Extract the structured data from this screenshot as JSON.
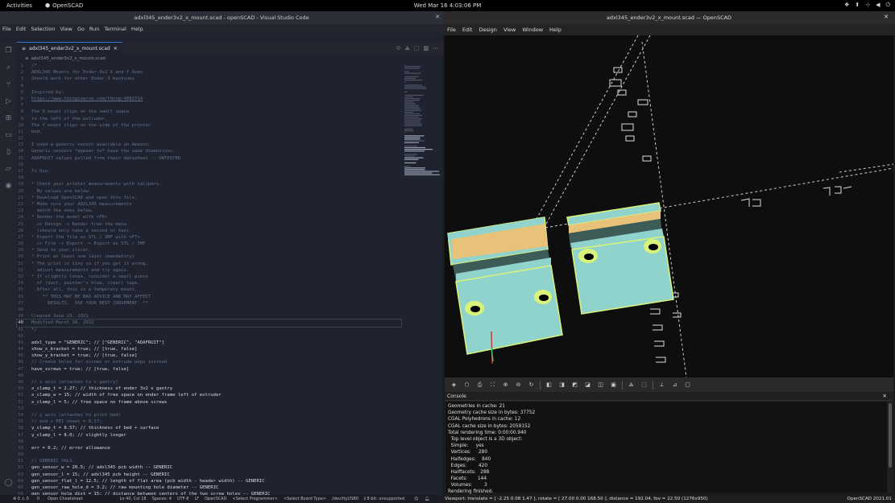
{
  "topbar": {
    "activities": "Activities",
    "app_name": "OpenSCAD",
    "clock": "Wed Mar 16  4:03:06 PM"
  },
  "vscode": {
    "title": "adxl345_ender3v2_x_mount.scad - openSCAD - Visual Studio Code",
    "menu": [
      "File",
      "Edit",
      "Selection",
      "View",
      "Go",
      "Run",
      "Terminal",
      "Help"
    ],
    "tab_label": "adxl345_ender3v2_x_mount.scad",
    "breadcrumb": "adxl345_ender3v2_x_mount.scad",
    "lines": [
      {
        "n": "1",
        "t": "/*",
        "c": "com"
      },
      {
        "n": "2",
        "t": "ADXL345 Mounts for Ender-3v2 X and Y Axes",
        "c": "com"
      },
      {
        "n": "3",
        "t": "Should work for other Ender-3 machines",
        "c": "com"
      },
      {
        "n": "4",
        "t": "",
        "c": "com"
      },
      {
        "n": "5",
        "t": "Inspired by:",
        "c": "com"
      },
      {
        "n": "6",
        "t": "https://www.thingiverse.com/thing:4882714",
        "c": "link"
      },
      {
        "n": "7",
        "t": "",
        "c": "com"
      },
      {
        "n": "8",
        "t": "The X mount clips on the small space",
        "c": "com"
      },
      {
        "n": "9",
        "t": "to the left of the extruder.",
        "c": "com"
      },
      {
        "n": "10",
        "t": "The Y mount clips on the side of the printer",
        "c": "com"
      },
      {
        "n": "11",
        "t": "bed.",
        "c": "com"
      },
      {
        "n": "12",
        "t": "",
        "c": "com"
      },
      {
        "n": "13",
        "t": "I used a generic sensor available on Amazon.",
        "c": "com"
      },
      {
        "n": "14",
        "t": "Generic sensors *appear to* have the same dimensions.",
        "c": "com"
      },
      {
        "n": "15",
        "t": "ADAFRUIT values pulled from their datasheet -- UNTESTED",
        "c": "com"
      },
      {
        "n": "16",
        "t": "",
        "c": "com"
      },
      {
        "n": "17",
        "t": "To Use:",
        "c": "com"
      },
      {
        "n": "18",
        "t": "",
        "c": "com"
      },
      {
        "n": "19",
        "t": "* Check your printer measurements with calipers.",
        "c": "com"
      },
      {
        "n": "20",
        "t": "  My values are below.",
        "c": "com"
      },
      {
        "n": "21",
        "t": "* Download OpenSCAD and open this file.",
        "c": "com"
      },
      {
        "n": "22",
        "t": "* Make sure your ADXL345 measurements",
        "c": "com"
      },
      {
        "n": "23",
        "t": "  match the ones below.",
        "c": "com"
      },
      {
        "n": "24",
        "t": "* Render the model with <F6>",
        "c": "com"
      },
      {
        "n": "25",
        "t": "  or Design -> Render from the menu",
        "c": "com"
      },
      {
        "n": "26",
        "t": "  (should only take a second or two).",
        "c": "com"
      },
      {
        "n": "27",
        "t": "* Export the file as STL / 3MF with <F7>",
        "c": "com"
      },
      {
        "n": "28",
        "t": "  or File -> Export -> Export as STL / 3MF",
        "c": "com"
      },
      {
        "n": "29",
        "t": "* Send to your slicer.",
        "c": "com"
      },
      {
        "n": "30",
        "t": "* Print at least one layer (mandatory)",
        "c": "com"
      },
      {
        "n": "31",
        "t": "* The print is tiny so if you get it wrong,",
        "c": "com"
      },
      {
        "n": "32",
        "t": "  adjust measurements and try again.",
        "c": "com"
      },
      {
        "n": "33",
        "t": "* If slightly loose, consider a small piece",
        "c": "com"
      },
      {
        "n": "34",
        "t": "  of (duct, painter's blue, clear) tape.",
        "c": "com"
      },
      {
        "n": "35",
        "t": "  After all, this is a temporary mount.",
        "c": "com"
      },
      {
        "n": "36",
        "t": "    ** THIS MAY BE BAD ADVICE AND MAY AFFECT",
        "c": "com"
      },
      {
        "n": "37",
        "t": "      RESULTS.  USE YOUR BEST JUDGEMENT. **",
        "c": "com"
      },
      {
        "n": "38",
        "t": "",
        "c": "com"
      },
      {
        "n": "39",
        "t": "Created June 23, 2021",
        "c": "com"
      },
      {
        "n": "40",
        "t": "Modified March 16, 2022",
        "c": "com",
        "cur": true
      },
      {
        "n": "41",
        "t": "*/",
        "c": "com"
      },
      {
        "n": "42",
        "t": "",
        "c": "code"
      },
      {
        "n": "43",
        "t": "adxl_type = \"GENERIC\"; // [\"GENERIC\", \"ADAFRUIT\"]",
        "c": "code"
      },
      {
        "n": "44",
        "t": "show_x_bracket = true; // [true, false]",
        "c": "code"
      },
      {
        "n": "45",
        "t": "show_y_bracket = true; // [true, false]",
        "c": "code"
      },
      {
        "n": "46",
        "t": "// Create holes for screws or extrude pegs instead",
        "c": "com"
      },
      {
        "n": "47",
        "t": "have_screws = true; // [true, false]",
        "c": "code"
      },
      {
        "n": "48",
        "t": "",
        "c": "code"
      },
      {
        "n": "49",
        "t": "// x axis (attaches to x gantry)",
        "c": "com"
      },
      {
        "n": "50",
        "t": "x_clamp_t = 2.27; // thickness of ender 3v2 x gantry",
        "c": "code"
      },
      {
        "n": "51",
        "t": "x_clamp_w = 15; // width of free space on ender frame left of extruder",
        "c": "code"
      },
      {
        "n": "52",
        "t": "x_clamp_l = 5; // free space on frame above screws",
        "c": "code"
      },
      {
        "n": "53",
        "t": "",
        "c": "code"
      },
      {
        "n": "54",
        "t": "// y axis (attaches to print bed)",
        "c": "com"
      },
      {
        "n": "55",
        "t": "// bed + PEI sheet = 8.57;",
        "c": "com"
      },
      {
        "n": "56",
        "t": "y_clamp_t = 8.57; // thickness of bed + surface",
        "c": "code"
      },
      {
        "n": "57",
        "t": "y_clamp_l = 8.0; // slightly longer",
        "c": "code"
      },
      {
        "n": "58",
        "t": "",
        "c": "code"
      },
      {
        "n": "59",
        "t": "err = 0.2; // error allowance",
        "c": "code"
      },
      {
        "n": "60",
        "t": "",
        "c": "code"
      },
      {
        "n": "61",
        "t": "// GENERIC VALS",
        "c": "com"
      },
      {
        "n": "62",
        "t": "gen_sensor_w = 20.5; // adxl345 pcb width -- GENERIC",
        "c": "code"
      },
      {
        "n": "63",
        "t": "gen_sensor_l = 15; // adxl345 pcb height -- GENERIC",
        "c": "code"
      },
      {
        "n": "64",
        "t": "gen_sensor_flat_l = 12.5; // length of flat area (pcb width - header width) -- GENERIC",
        "c": "code"
      },
      {
        "n": "65",
        "t": "gen_sensor_raw_hole_d = 3.2; // raw mounting hole diameter -- GENERIC",
        "c": "code"
      },
      {
        "n": "66",
        "t": "gen_sensor_hole_dist = 15; // distance between centers of the two screw holes -- GENERIC",
        "c": "code"
      }
    ],
    "status_left": [
      "⊗ 0 ⚠ 0",
      "0",
      "Open Cheatsheet"
    ],
    "status_right": [
      "Ln 40, Col 18",
      "Spaces: 4",
      "UTF-8",
      "LF",
      "OpenSCAD",
      "<Select Programmer>",
      "<Select Board Type>",
      "/dev/ttyUSB0",
      "ℹ 8-bit: unsupported"
    ]
  },
  "openscad": {
    "title": "adxl345_ender3v2_x_mount.scad — OpenSCAD",
    "menu": [
      "File",
      "Edit",
      "Design",
      "View",
      "Window",
      "Help"
    ],
    "console_title": "Console",
    "console_lines": [
      "Geometries in cache: 21",
      "Geometry cache size in bytes: 37752",
      "CGAL Polyhedrons in cache: 12",
      "CGAL cache size in bytes: 2059152",
      "Total rendering time: 0:00:00.940",
      "  Top level object is a 3D object:",
      "  Simple:     yes",
      "  Vertices:     280",
      "  Halfedges:    840",
      "  Edges:        420",
      "  Halffacets:   288",
      "  Facets:       144",
      "  Volumes:        3",
      "Rendering finished."
    ],
    "viewport_status": "Viewport: translate = [ -2.25 0.08 1.47 ], rotate = [ 27.00 0.00 168.50 ], distance = 192.04, fov = 22.50 (1276x950)",
    "version": "OpenSCAD 2021.01",
    "colors": {
      "model_face": "#8fd3cc",
      "model_top": "#e9c27a",
      "model_dark": "#3d5b57",
      "highlight": "#d9f37a"
    }
  }
}
